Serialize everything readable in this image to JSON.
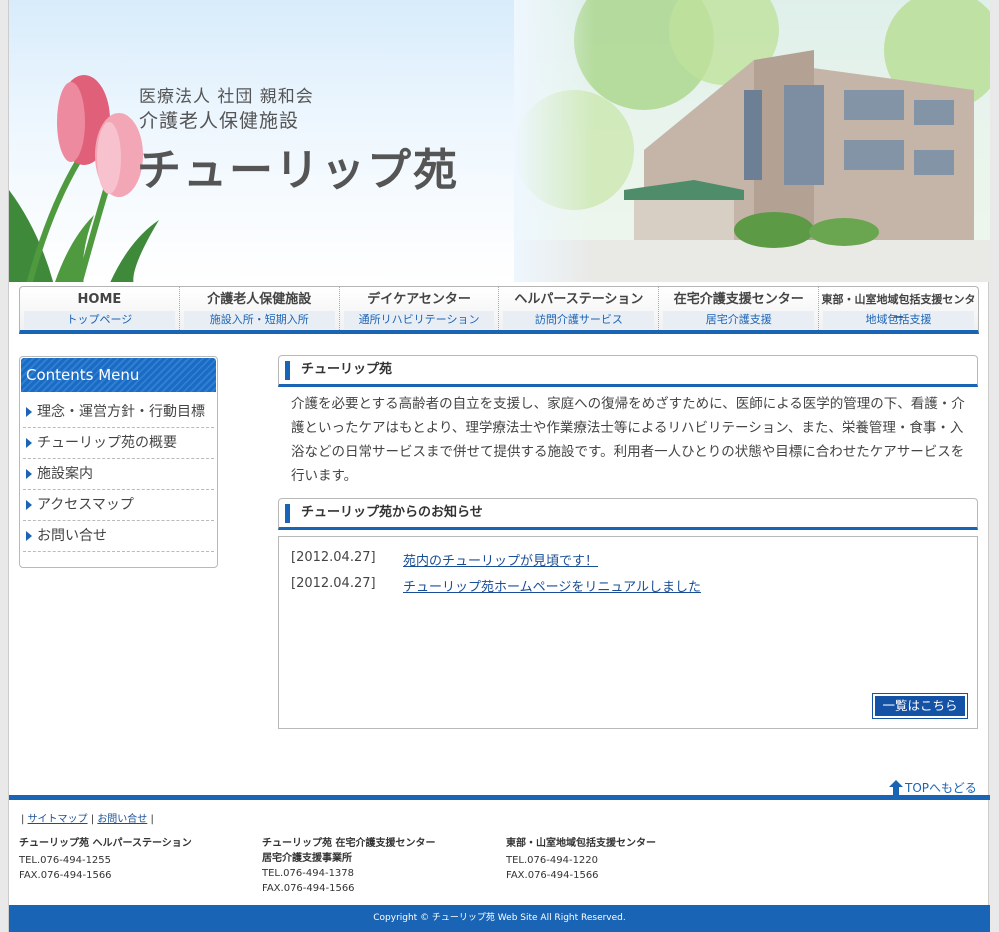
{
  "header": {
    "org_line": "医療法人 社団 親和会",
    "facility_type": "介護老人保健施設",
    "site_title": "チューリップ苑"
  },
  "nav": [
    {
      "main": "HOME",
      "sub": "トップページ"
    },
    {
      "main": "介護老人保健施設",
      "sub": "施設入所・短期入所"
    },
    {
      "main": "デイケアセンター",
      "sub": "通所リハビリテーション"
    },
    {
      "main": "ヘルパーステーション",
      "sub": "訪問介護サービス"
    },
    {
      "main": "在宅介護支援センター",
      "sub": "居宅介護支援"
    },
    {
      "main": "東部・山室地域包括支援センター",
      "sub": "地域包括支援"
    }
  ],
  "sidebar": {
    "title": "Contents Menu",
    "items": [
      {
        "label": "理念・運営方針・行動目標"
      },
      {
        "label": "チューリップ苑の概要"
      },
      {
        "label": "施設案内"
      },
      {
        "label": "アクセスマップ"
      },
      {
        "label": "お問い合せ"
      }
    ]
  },
  "main": {
    "intro_title": "チューリップ苑",
    "intro_text": "介護を必要とする高齢者の自立を支援し、家庭への復帰をめざすために、医師による医学的管理の下、看護・介護といったケアはもとより、理学療法士や作業療法士等によるリハビリテーション、また、栄養管理・食事・入浴などの日常サービスまで併せて提供する施設です。利用者一人ひとりの状態や目標に合わせたケアサービスを行います。",
    "news_title": "チューリップ苑からのお知らせ",
    "news": [
      {
        "date": "[2012.04.27]",
        "title": "苑内のチューリップが見頃です！"
      },
      {
        "date": "[2012.04.27]",
        "title": "チューリップ苑ホームページをリニュアルしました"
      }
    ],
    "more_label": "一覧はこちら"
  },
  "top_link": "TOPへもどる",
  "footer": {
    "sitemap": "サイトマップ",
    "contact": "お問い合せ",
    "columns": [
      {
        "name": "チューリップ苑 ヘルパーステーション",
        "name2": "",
        "tel": "TEL.076-494-1255",
        "fax": "FAX.076-494-1566"
      },
      {
        "name": "チューリップ苑 在宅介護支援センター",
        "name2": "居宅介護支援事業所",
        "tel": "TEL.076-494-1378",
        "fax": "FAX.076-494-1566"
      },
      {
        "name": "東部・山室地域包括支援センター",
        "name2": "",
        "tel": "TEL.076-494-1220",
        "fax": "FAX.076-494-1566"
      }
    ],
    "copyright": "Copyright © チューリップ苑 Web Site All Right Reserved."
  },
  "colors": {
    "accent": "#1a64b6",
    "link": "#1a4f96"
  }
}
